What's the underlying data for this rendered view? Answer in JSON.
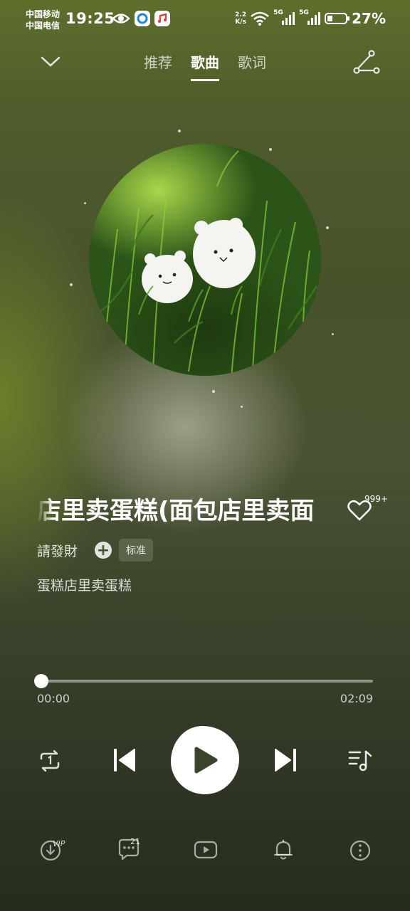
{
  "status_bar": {
    "carrier1": "中国移动",
    "carrier2": "中国电信",
    "time": "19:25",
    "net_speed_value": "2.2",
    "net_speed_unit": "K/s",
    "signal1_label": "5G",
    "signal2_label": "5G",
    "battery_percent": "27%"
  },
  "nav": {
    "tabs": [
      {
        "label": "推荐",
        "active": false
      },
      {
        "label": "歌曲",
        "active": true
      },
      {
        "label": "歌词",
        "active": false
      }
    ]
  },
  "song": {
    "title": "店里卖蛋糕(面包店里卖面",
    "artist": "請發財",
    "quality": "标准",
    "subtitle": "蛋糕店里卖蛋糕",
    "like_count": "999+"
  },
  "player": {
    "current_time": "00:00",
    "total_time": "02:09",
    "progress": 0.0
  },
  "bottom_bar": {
    "download_badge": "VIP",
    "comments_count": "21"
  },
  "icons": [
    "chevron-down-icon",
    "share-icon",
    "heart-icon",
    "plus-icon",
    "repeat-one-icon",
    "previous-icon",
    "play-icon",
    "next-icon",
    "playlist-icon",
    "download-icon",
    "comment-icon",
    "video-icon",
    "bell-icon",
    "more-icon"
  ]
}
